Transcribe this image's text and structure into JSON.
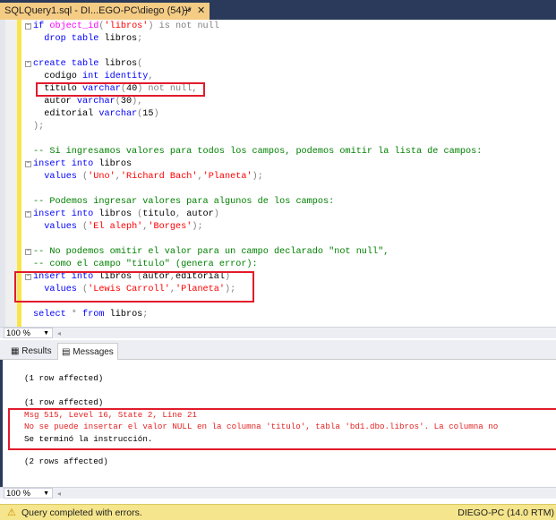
{
  "tab": {
    "title": "SQLQuery1.sql - DI...EGO-PC\\diego (54))*",
    "pin_icon": "pin-icon",
    "close_icon": "close-icon"
  },
  "editor": {
    "lines": [
      {
        "fold": true,
        "tokens": [
          [
            "kw",
            "if "
          ],
          [
            "fn",
            "object_id"
          ],
          [
            "gr",
            "("
          ],
          [
            "str",
            "'libros'"
          ],
          [
            "gr",
            ") is not null"
          ]
        ]
      },
      {
        "tokens": [
          [
            "tx",
            "  "
          ],
          [
            "kw",
            "drop table "
          ],
          [
            "tx",
            "libros"
          ],
          [
            "gr",
            ";"
          ]
        ]
      },
      {
        "tokens": []
      },
      {
        "fold": true,
        "tokens": [
          [
            "kw",
            "create table "
          ],
          [
            "tx",
            "libros"
          ],
          [
            "gr",
            "("
          ]
        ]
      },
      {
        "tokens": [
          [
            "tx",
            "  codigo "
          ],
          [
            "kw",
            "int identity"
          ],
          [
            "gr",
            ","
          ]
        ]
      },
      {
        "tokens": [
          [
            "tx",
            "  titulo "
          ],
          [
            "kw",
            "varchar"
          ],
          [
            "gr",
            "("
          ],
          [
            "tx",
            "40"
          ],
          [
            "gr",
            ") not null,"
          ]
        ]
      },
      {
        "tokens": [
          [
            "tx",
            "  autor "
          ],
          [
            "kw",
            "varchar"
          ],
          [
            "gr",
            "("
          ],
          [
            "tx",
            "30"
          ],
          [
            "gr",
            "),"
          ]
        ]
      },
      {
        "tokens": [
          [
            "tx",
            "  editorial "
          ],
          [
            "kw",
            "varchar"
          ],
          [
            "gr",
            "("
          ],
          [
            "tx",
            "15"
          ],
          [
            "gr",
            ")"
          ]
        ]
      },
      {
        "tokens": [
          [
            "gr",
            ");"
          ]
        ]
      },
      {
        "tokens": []
      },
      {
        "tokens": [
          [
            "cm",
            "-- Si ingresamos valores para todos los campos, podemos omitir la lista de campos:"
          ]
        ]
      },
      {
        "fold": true,
        "tokens": [
          [
            "kw",
            "insert into "
          ],
          [
            "tx",
            "libros"
          ]
        ]
      },
      {
        "tokens": [
          [
            "tx",
            "  "
          ],
          [
            "kw",
            "values "
          ],
          [
            "gr",
            "("
          ],
          [
            "str",
            "'Uno'"
          ],
          [
            "gr",
            ","
          ],
          [
            "str",
            "'Richard Bach'"
          ],
          [
            "gr",
            ","
          ],
          [
            "str",
            "'Planeta'"
          ],
          [
            "gr",
            ");"
          ]
        ]
      },
      {
        "tokens": []
      },
      {
        "tokens": [
          [
            "cm",
            "-- Podemos ingresar valores para algunos de los campos:"
          ]
        ]
      },
      {
        "fold": true,
        "tokens": [
          [
            "kw",
            "insert into "
          ],
          [
            "tx",
            "libros "
          ],
          [
            "gr",
            "("
          ],
          [
            "tx",
            "titulo"
          ],
          [
            "gr",
            ", "
          ],
          [
            "tx",
            "autor"
          ],
          [
            "gr",
            ")"
          ]
        ]
      },
      {
        "tokens": [
          [
            "tx",
            "  "
          ],
          [
            "kw",
            "values "
          ],
          [
            "gr",
            "("
          ],
          [
            "str",
            "'El aleph'"
          ],
          [
            "gr",
            ","
          ],
          [
            "str",
            "'Borges'"
          ],
          [
            "gr",
            ");"
          ]
        ]
      },
      {
        "tokens": []
      },
      {
        "fold": true,
        "tokens": [
          [
            "cm",
            "-- No podemos omitir el valor para un campo declarado \"not null\","
          ]
        ]
      },
      {
        "tokens": [
          [
            "cm",
            "-- como el campo \"titulo\" (genera error):"
          ]
        ]
      },
      {
        "fold": true,
        "tokens": [
          [
            "kw",
            "insert into "
          ],
          [
            "tx",
            "libros "
          ],
          [
            "gr",
            "("
          ],
          [
            "tx",
            "autor"
          ],
          [
            "gr",
            ","
          ],
          [
            "tx",
            "editorial"
          ],
          [
            "gr",
            ")"
          ]
        ]
      },
      {
        "tokens": [
          [
            "tx",
            "  "
          ],
          [
            "kw",
            "values "
          ],
          [
            "gr",
            "("
          ],
          [
            "str",
            "'Lewis Carroll'"
          ],
          [
            "gr",
            ","
          ],
          [
            "str",
            "'Planeta'"
          ],
          [
            "gr",
            ");"
          ]
        ]
      },
      {
        "tokens": []
      },
      {
        "tokens": [
          [
            "kw",
            "select "
          ],
          [
            "gr",
            "* "
          ],
          [
            "kw",
            "from "
          ],
          [
            "tx",
            "libros"
          ],
          [
            "gr",
            ";"
          ]
        ]
      }
    ]
  },
  "zoom_top": "100 %",
  "zoom_bottom": "100 %",
  "result_tabs": {
    "results": "Results",
    "messages": "Messages"
  },
  "messages": {
    "m1": "(1 row affected)",
    "m2": "(1 row affected)",
    "err1": "Msg 515, Level 16, State 2, Line 21",
    "err2": "No se puede insertar el valor NULL en la columna 'titulo', tabla 'bd1.dbo.libros'. La columna no",
    "m3": "Se terminó la instrucción.",
    "m4": "(2 rows affected)"
  },
  "status": {
    "text": "Query completed with errors.",
    "server": "DIEGO-PC (14.0 RTM)",
    "warning_icon": "warning-icon"
  },
  "colors": {
    "highlight_box": "#e21b2b",
    "status_bar": "#f5e58c",
    "tab": "#f5cc84"
  }
}
